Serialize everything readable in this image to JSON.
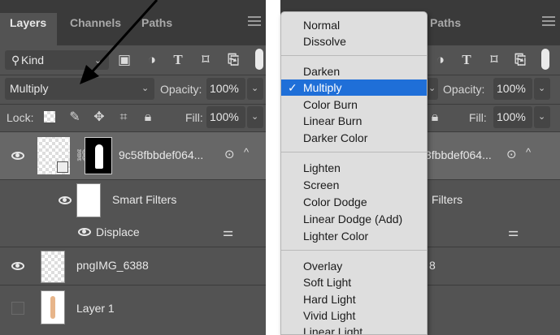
{
  "tabs": {
    "layers": "Layers",
    "channels": "Channels",
    "paths": "Paths"
  },
  "filter": {
    "kind_label": "Kind"
  },
  "blend": {
    "current": "Multiply",
    "opacity_label": "Opacity:",
    "opacity_value": "100%"
  },
  "lock": {
    "label": "Lock:",
    "fill_label": "Fill:",
    "fill_value": "100%"
  },
  "layers": {
    "smart_object": "9c58fbbdef064...",
    "smart_object_right": "3fbbdef064...",
    "smart_filters": "Smart Filters",
    "smart_filters_right": "Filters",
    "displace": "Displace",
    "png_layer": "pngIMG_6388",
    "png_layer_right": "8",
    "layer1": "Layer 1"
  },
  "blend_menu": {
    "check": "✓",
    "items": [
      "Normal",
      "Dissolve",
      "Darken",
      "Multiply",
      "Color Burn",
      "Linear Burn",
      "Darker Color",
      "Lighten",
      "Screen",
      "Color Dodge",
      "Linear Dodge (Add)",
      "Lighter Color",
      "Overlay",
      "Soft Light",
      "Hard Light",
      "Vivid Light",
      "Linear Light"
    ],
    "selected": "Multiply"
  },
  "icons": {
    "search": "search-icon",
    "image": "image-filter-icon",
    "adjust": "adjustment-filter-icon",
    "type": "type-filter-icon",
    "shape": "shape-filter-icon",
    "smart": "smart-object-filter-icon",
    "panel_menu": "panel-menu-icon"
  },
  "colors": {
    "panel_bg": "#535353",
    "tabbar_bg": "#3a3a3a",
    "selected_layer": "#676767",
    "menu_bg": "#dedede",
    "menu_highlight": "#1f6fd8"
  }
}
